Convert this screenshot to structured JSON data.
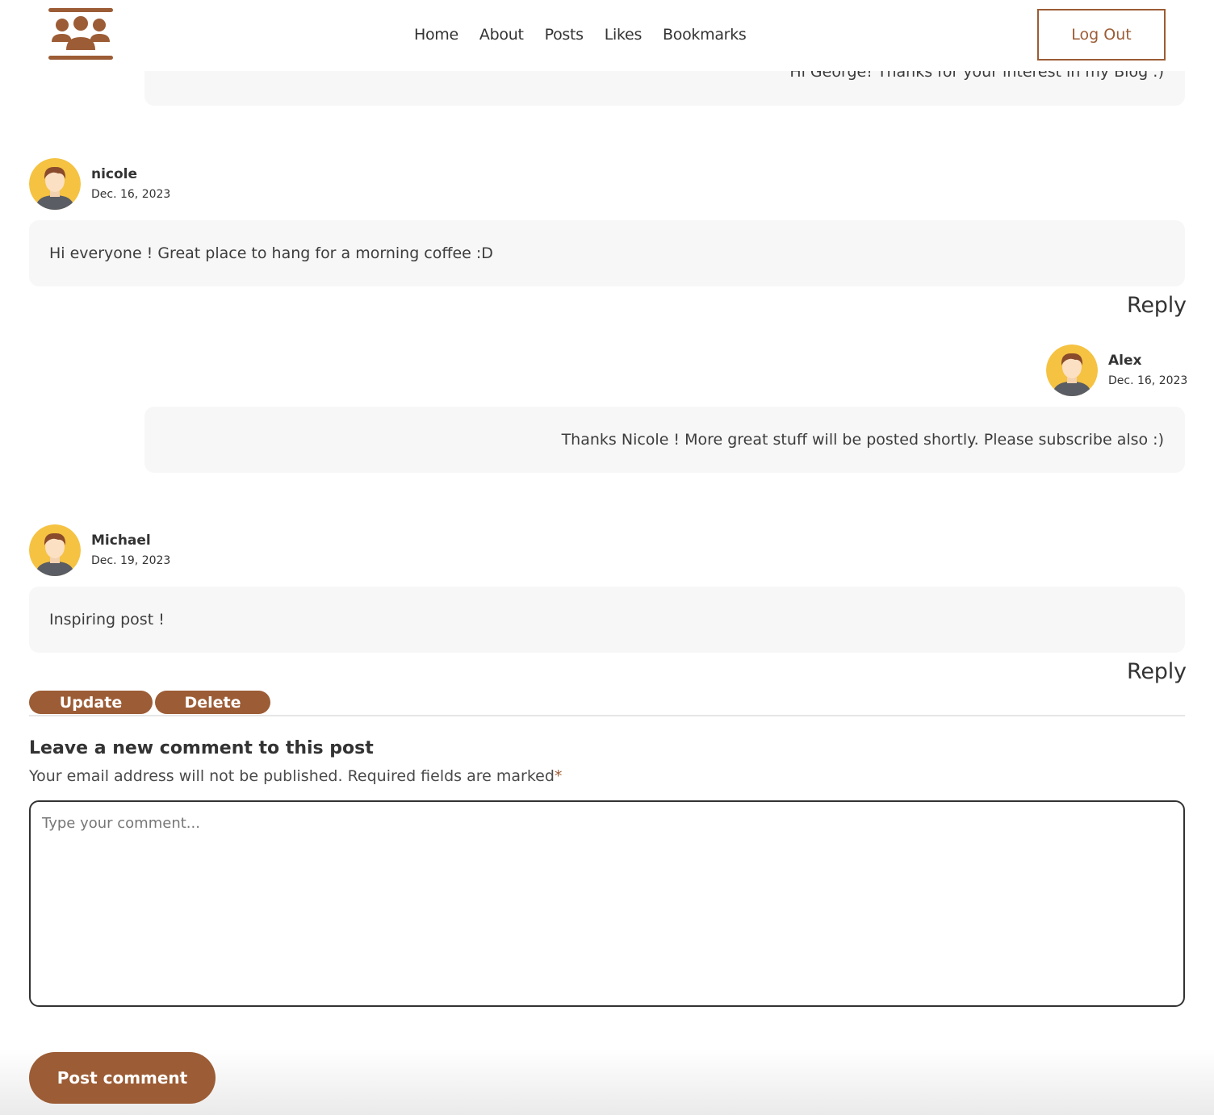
{
  "nav": {
    "links": [
      "Home",
      "About",
      "Posts",
      "Likes",
      "Bookmarks"
    ],
    "logout_label": "Log Out"
  },
  "colors": {
    "accent": "#9c5c35",
    "comment_bg": "#f7f7f7",
    "avatar_bg": "#f5c242"
  },
  "comments": {
    "reply_to_george": {
      "text": "Hi George! Thanks for your interest in my Blog :)"
    },
    "nicole": {
      "author": "nicole",
      "date": "Dec. 16, 2023",
      "text": "Hi everyone ! Great place to hang for a morning coffee :D",
      "reply_label": "Reply"
    },
    "alex_reply": {
      "author": "Alex",
      "date": "Dec. 16, 2023",
      "text": "Thanks Nicole ! More great stuff will be posted shortly. Please subscribe also :)"
    },
    "michael": {
      "author": "Michael",
      "date": "Dec. 19, 2023",
      "text": "Inspiring post !",
      "reply_label": "Reply"
    }
  },
  "actions": {
    "update_label": "Update",
    "delete_label": "Delete"
  },
  "form": {
    "title": "Leave a new comment to this post",
    "note": "Your email address will not be published. Required fields are marked",
    "required_mark": "*",
    "placeholder": "Type your comment...",
    "submit_label": "Post comment"
  }
}
